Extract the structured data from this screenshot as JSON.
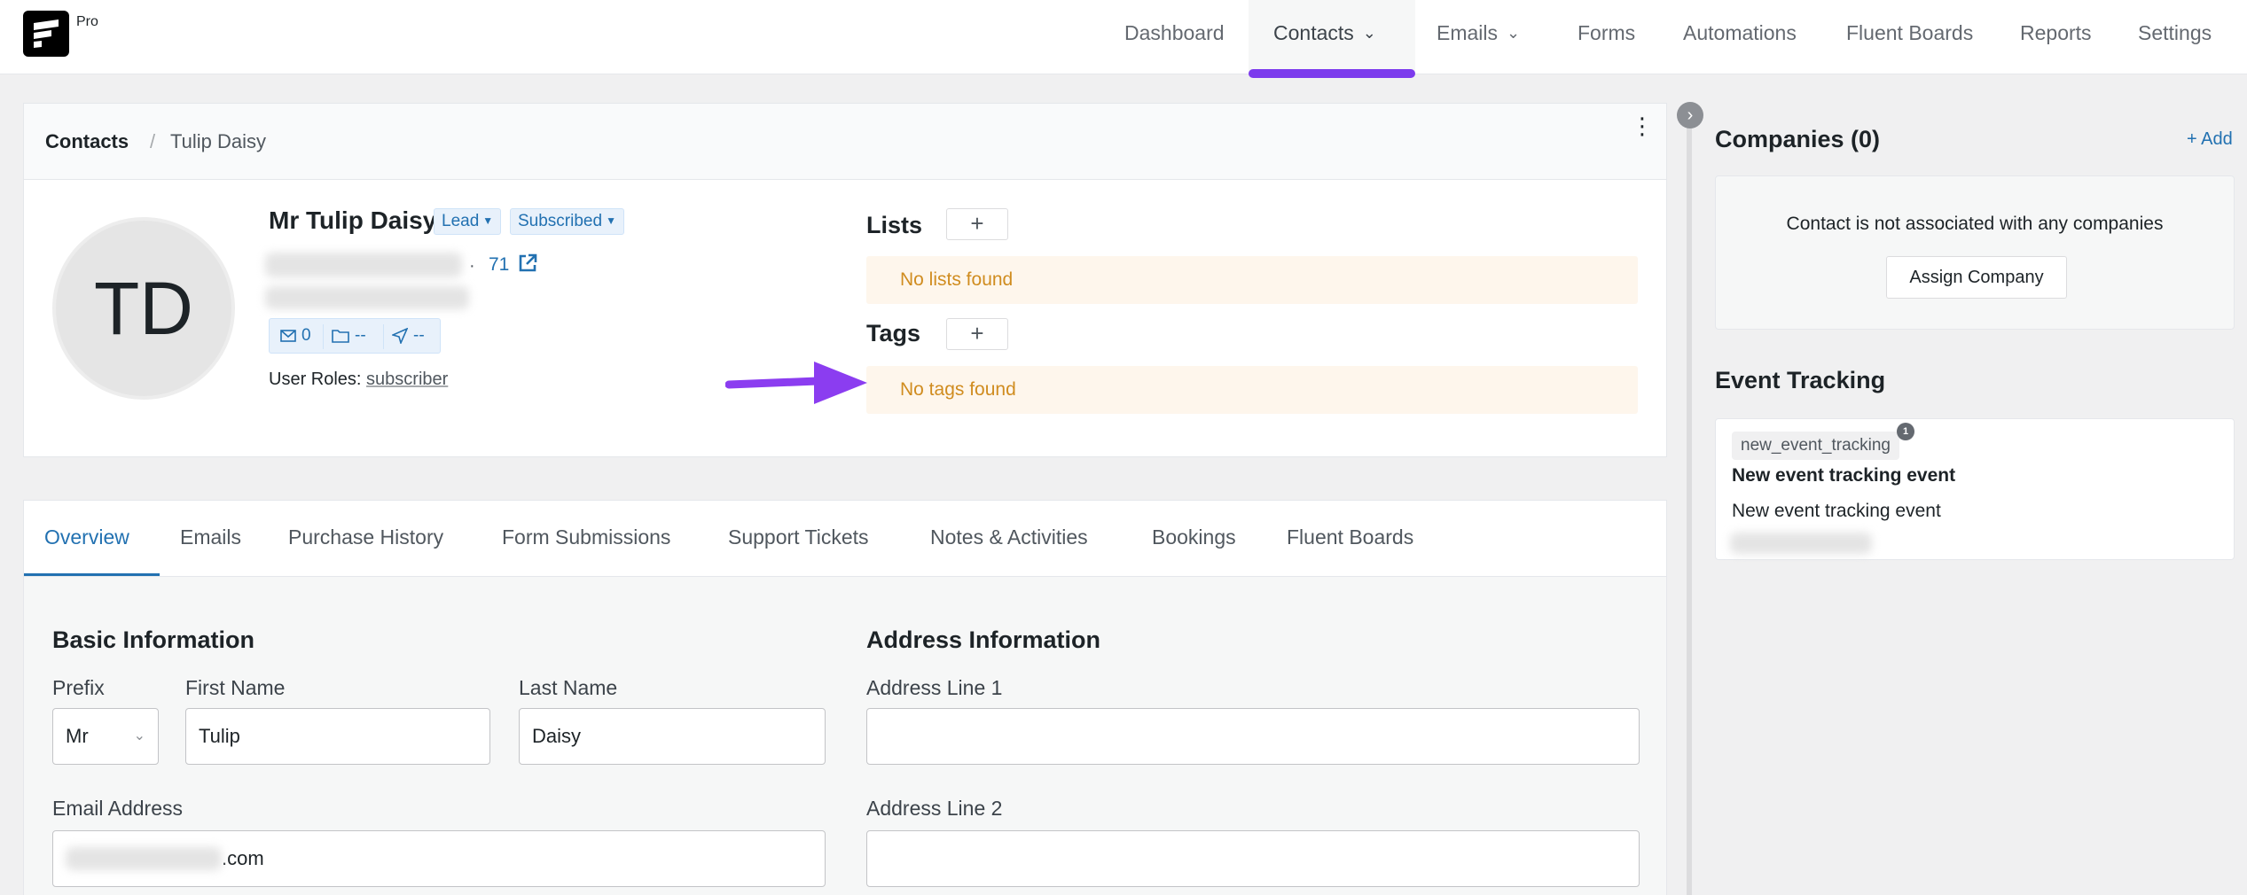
{
  "nav": {
    "pro_label": "Pro",
    "items": [
      {
        "label": "Dashboard"
      },
      {
        "label": "Contacts"
      },
      {
        "label": "Emails"
      },
      {
        "label": "Forms"
      },
      {
        "label": "Automations"
      },
      {
        "label": "Fluent Boards"
      },
      {
        "label": "Reports"
      },
      {
        "label": "Settings"
      }
    ],
    "active": "Contacts",
    "accent_color": "#7c3aed"
  },
  "breadcrumb": {
    "root": "Contacts",
    "sep": "/",
    "current": "Tulip Daisy"
  },
  "contact": {
    "initials": "TD",
    "name": "Mr Tulip Daisy",
    "status_badge": "Lead",
    "subscription_badge": "Subscribed",
    "dot": "·",
    "id_link": "71",
    "stats": {
      "emails": "0",
      "folders": "--",
      "sent": "--"
    },
    "roles_label": "User Roles:",
    "roles_value": "subscriber"
  },
  "lists": {
    "title": "Lists",
    "add": "+",
    "empty": "No lists found"
  },
  "tags": {
    "title": "Tags",
    "add": "+",
    "empty": "No tags found"
  },
  "sidebar": {
    "companies_title": "Companies (0)",
    "add_link": "+ Add",
    "companies_empty": "Contact is not associated with any companies",
    "assign_button": "Assign Company",
    "event_title": "Event Tracking",
    "event": {
      "tag": "new_event_tracking",
      "count": "1",
      "title": "New event tracking event",
      "description": "New event tracking event"
    }
  },
  "tabs": [
    {
      "label": "Overview"
    },
    {
      "label": "Emails"
    },
    {
      "label": "Purchase History"
    },
    {
      "label": "Form Submissions"
    },
    {
      "label": "Support Tickets"
    },
    {
      "label": "Notes & Activities"
    },
    {
      "label": "Bookings"
    },
    {
      "label": "Fluent Boards"
    }
  ],
  "active_tab": "Overview",
  "basic_info": {
    "title": "Basic Information",
    "prefix_label": "Prefix",
    "prefix_value": "Mr",
    "first_name_label": "First Name",
    "first_name_value": "Tulip",
    "last_name_label": "Last Name",
    "last_name_value": "Daisy",
    "email_label": "Email Address",
    "email_suffix": ".com"
  },
  "address_info": {
    "title": "Address Information",
    "line1_label": "Address Line 1",
    "line1_value": "",
    "line2_label": "Address Line 2",
    "line2_value": ""
  }
}
